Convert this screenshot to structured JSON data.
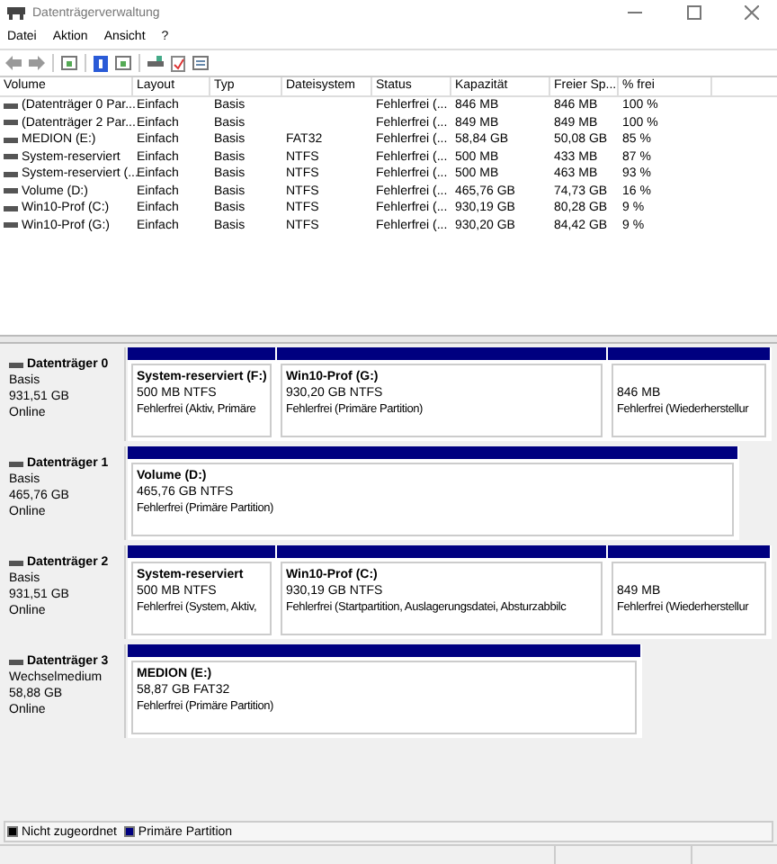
{
  "window": {
    "title": "Datenträgerverwaltung"
  },
  "menu": [
    "Datei",
    "Aktion",
    "Ansicht",
    "?"
  ],
  "table": {
    "columns": [
      "Volume",
      "Layout",
      "Typ",
      "Dateisystem",
      "Status",
      "Kapazität",
      "Freier Sp...",
      "% frei"
    ],
    "rows": [
      [
        "(Datenträger 0 Par...",
        "Einfach",
        "Basis",
        "",
        "Fehlerfrei (...",
        "846 MB",
        "846 MB",
        "100 %"
      ],
      [
        "(Datenträger 2 Par...",
        "Einfach",
        "Basis",
        "",
        "Fehlerfrei (...",
        "849 MB",
        "849 MB",
        "100 %"
      ],
      [
        "MEDION (E:)",
        "Einfach",
        "Basis",
        "FAT32",
        "Fehlerfrei (...",
        "58,84 GB",
        "50,08 GB",
        "85 %"
      ],
      [
        "System-reserviert",
        "Einfach",
        "Basis",
        "NTFS",
        "Fehlerfrei (...",
        "500 MB",
        "433 MB",
        "87 %"
      ],
      [
        "System-reserviert (...",
        "Einfach",
        "Basis",
        "NTFS",
        "Fehlerfrei (...",
        "500 MB",
        "463 MB",
        "93 %"
      ],
      [
        "Volume (D:)",
        "Einfach",
        "Basis",
        "NTFS",
        "Fehlerfrei (...",
        "465,76 GB",
        "74,73 GB",
        "16 %"
      ],
      [
        "Win10-Prof (C:)",
        "Einfach",
        "Basis",
        "NTFS",
        "Fehlerfrei (...",
        "930,19 GB",
        "80,28 GB",
        "9 %"
      ],
      [
        "Win10-Prof (G:)",
        "Einfach",
        "Basis",
        "NTFS",
        "Fehlerfrei (...",
        "930,20 GB",
        "84,42 GB",
        "9 %"
      ]
    ]
  },
  "disks": [
    {
      "name": "Datenträger 0",
      "type": "Basis",
      "size": "931,51 GB",
      "state": "Online",
      "partitions": [
        {
          "kind": "primary",
          "name": "System-reserviert  (F:)",
          "size": "500 MB NTFS",
          "status": "Fehlerfrei (Aktiv, Primäre"
        },
        {
          "kind": "primary",
          "name": "Win10-Prof  (G:)",
          "size": "930,20 GB NTFS",
          "status": "Fehlerfrei (Primäre Partition)"
        },
        {
          "kind": "primary",
          "size": "846 MB",
          "status": "Fehlerfrei (Wiederherstellur"
        }
      ]
    },
    {
      "name": "Datenträger 1",
      "type": "Basis",
      "size": "465,76 GB",
      "state": "Online",
      "partitions": [
        {
          "kind": "primary",
          "name": "Volume  (D:)",
          "size": "465,76 GB NTFS",
          "status": "Fehlerfrei (Primäre Partition)"
        }
      ]
    },
    {
      "name": "Datenträger 2",
      "type": "Basis",
      "size": "931,51 GB",
      "state": "Online",
      "partitions": [
        {
          "kind": "primary",
          "name": "System-reserviert",
          "size": "500 MB NTFS",
          "status": "Fehlerfrei (System, Aktiv,"
        },
        {
          "kind": "primary",
          "name": "Win10-Prof  (C:)",
          "size": "930,19 GB NTFS",
          "status": "Fehlerfrei (Startpartition, Auslagerungsdatei, Absturzabbilc"
        },
        {
          "kind": "primary",
          "size": "849 MB",
          "status": "Fehlerfrei (Wiederherstellur"
        }
      ]
    },
    {
      "name": "Datenträger 3",
      "type": "Wechselmedium",
      "size": "58,88 GB",
      "state": "Online",
      "partitions": [
        {
          "kind": "primary",
          "name": "MEDION  (E:)",
          "size": "58,87 GB FAT32",
          "status": "Fehlerfrei (Primäre Partition)"
        }
      ]
    }
  ],
  "legend": [
    {
      "label": "Nicht zugeordnet",
      "color": "#000000"
    },
    {
      "label": "Primäre Partition",
      "color": "#000080"
    }
  ]
}
